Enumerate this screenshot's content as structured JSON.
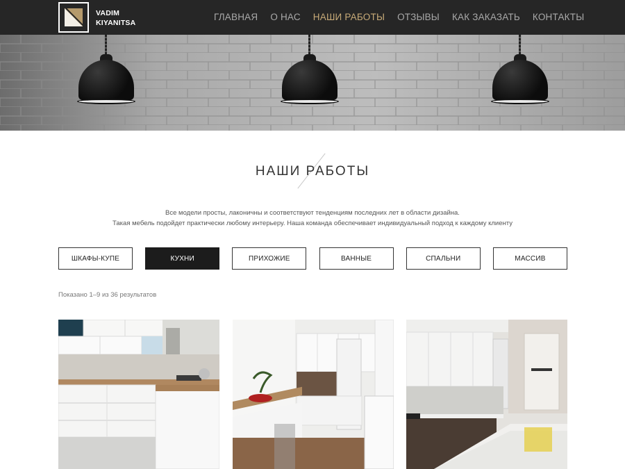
{
  "header": {
    "brand_line1": "VADIM",
    "brand_line2": "KIYANITSA",
    "nav": [
      {
        "label": "ГЛАВНАЯ",
        "active": false
      },
      {
        "label": "О НАС",
        "active": false
      },
      {
        "label": "НАШИ РАБОТЫ",
        "active": true
      },
      {
        "label": "ОТЗЫВЫ",
        "active": false
      },
      {
        "label": "КАК ЗАКАЗАТЬ",
        "active": false
      },
      {
        "label": "КОНТАКТЫ",
        "active": false
      }
    ]
  },
  "main": {
    "title": "НАШИ РАБОТЫ",
    "intro_line1": "Все модели просты, лаконичны и соответствуют тенденциям последних лет в области дизайна.",
    "intro_line2": "Такая мебель подойдет практически любому интерьеру. Наша команда обеспечивает индивидуальный подход к каждому клиенту",
    "filters": [
      {
        "label": "ШКАФЫ-КУПЕ",
        "active": false
      },
      {
        "label": "КУХНИ",
        "active": true
      },
      {
        "label": "ПРИХОЖИЕ",
        "active": false
      },
      {
        "label": "ВАННЫЕ",
        "active": false
      },
      {
        "label": "СПАЛЬНИ",
        "active": false
      },
      {
        "label": "МАССИВ",
        "active": false
      }
    ],
    "results_text": "Показано 1–9 из 36 результатов"
  },
  "colors": {
    "header_bg": "#262626",
    "accent_gold": "#c8ab78",
    "nav_text": "#a9a9a9",
    "active_filter_bg": "#1c1c1c"
  }
}
